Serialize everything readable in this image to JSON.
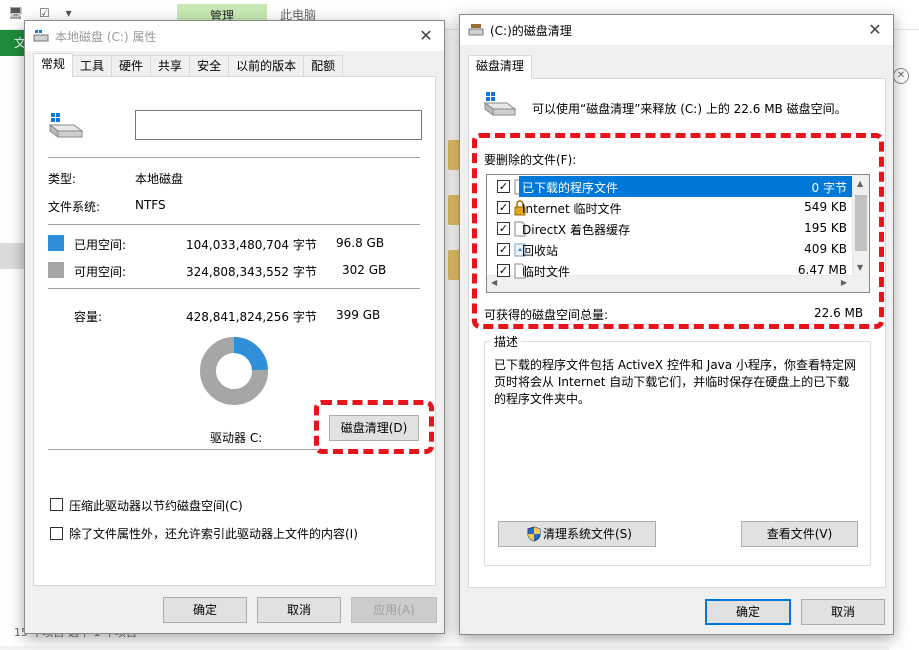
{
  "explorer": {
    "ribbon_tab_file": "文",
    "manage_tab": "管理",
    "window_title": "此电脑",
    "status_bar": "15 个项目   选中 1 个项目"
  },
  "properties": {
    "title": "本地磁盘 (C:) 属性",
    "tabs": [
      "常规",
      "工具",
      "硬件",
      "共享",
      "安全",
      "以前的版本",
      "配额"
    ],
    "name_value": "",
    "type_label": "类型:",
    "type_value": "本地磁盘",
    "fs_label": "文件系统:",
    "fs_value": "NTFS",
    "used_label": "已用空间:",
    "used_bytes": "104,033,480,704 字节",
    "used_gb": "96.8 GB",
    "free_label": "可用空间:",
    "free_bytes": "324,808,343,552 字节",
    "free_gb": "302 GB",
    "capacity_label": "容量:",
    "capacity_bytes": "428,841,824,256 字节",
    "capacity_gb": "399 GB",
    "used_fraction": 0.243,
    "drive_label": "驱动器 C:",
    "cleanup_button": "磁盘清理(D)",
    "compress_label": "压缩此驱动器以节约磁盘空间(C)",
    "index_label": "除了文件属性外，还允许索引此驱动器上文件的内容(I)",
    "ok": "确定",
    "cancel": "取消",
    "apply": "应用(A)",
    "colors": {
      "used": "#2f8fd8",
      "free": "#a6a6a6",
      "highlight": "#e8131b"
    }
  },
  "cleanup": {
    "title": "(C:)的磁盘清理",
    "tab": "磁盘清理",
    "summary": "可以使用“磁盘清理”来释放  (C:) 上的 22.6 MB 磁盘空间。",
    "files_label": "要删除的文件(F):",
    "items": [
      {
        "name": "已下载的程序文件",
        "size": "0 字节",
        "checked": true,
        "selected": true,
        "icon": "blank-page-icon"
      },
      {
        "name": "Internet 临时文件",
        "size": "549 KB",
        "checked": true,
        "selected": false,
        "icon": "lock-icon"
      },
      {
        "name": "DirectX 着色器缓存",
        "size": "195 KB",
        "checked": true,
        "selected": false,
        "icon": "blank-page-icon"
      },
      {
        "name": "回收站",
        "size": "409 KB",
        "checked": true,
        "selected": false,
        "icon": "recycle-bin-icon"
      },
      {
        "name": "临时文件",
        "size": "6.47 MB",
        "checked": true,
        "selected": false,
        "icon": "blank-page-icon"
      }
    ],
    "total_label": "可获得的磁盘空间总量:",
    "total_value": "22.6 MB",
    "desc_group": "描述",
    "description": "已下载的程序文件包括 ActiveX 控件和 Java 小程序，你查看特定网页时将会从 Internet 自动下载它们，并临时保存在硬盘上的已下载的程序文件夹中。",
    "clean_system_button": "清理系统文件(S)",
    "view_files_button": "查看文件(V)",
    "ok": "确定",
    "cancel": "取消"
  }
}
